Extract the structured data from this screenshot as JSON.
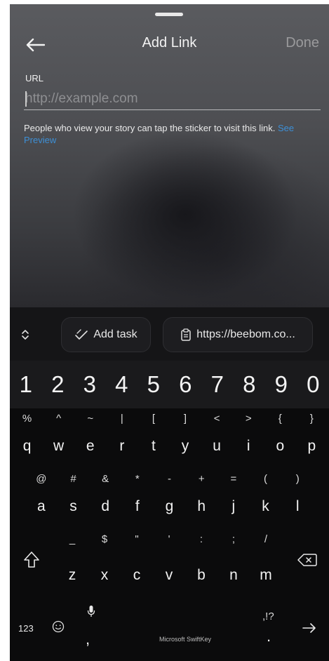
{
  "header": {
    "title": "Add Link",
    "done_label": "Done"
  },
  "url_field": {
    "label": "URL",
    "placeholder": "http://example.com",
    "value": ""
  },
  "help": {
    "text": "People who view your story can tap the sticker to visit this link. ",
    "link_text": "See Preview"
  },
  "keyboard": {
    "suggestions": {
      "add_task": "Add task",
      "clipboard": "https://beebom.co..."
    },
    "number_row": [
      "1",
      "2",
      "3",
      "4",
      "5",
      "6",
      "7",
      "8",
      "9",
      "0"
    ],
    "row1": [
      {
        "sym": "%",
        "main": "q"
      },
      {
        "sym": "^",
        "main": "w"
      },
      {
        "sym": "~",
        "main": "e"
      },
      {
        "sym": "|",
        "main": "r"
      },
      {
        "sym": "[",
        "main": "t"
      },
      {
        "sym": "]",
        "main": "y"
      },
      {
        "sym": "<",
        "main": "u"
      },
      {
        "sym": ">",
        "main": "i"
      },
      {
        "sym": "{",
        "main": "o"
      },
      {
        "sym": "}",
        "main": "p"
      }
    ],
    "row2": [
      {
        "sym": "@",
        "main": "a"
      },
      {
        "sym": "#",
        "main": "s"
      },
      {
        "sym": "&",
        "main": "d"
      },
      {
        "sym": "*",
        "main": "f"
      },
      {
        "sym": "-",
        "main": "g"
      },
      {
        "sym": "+",
        "main": "h"
      },
      {
        "sym": "=",
        "main": "j"
      },
      {
        "sym": "(",
        "main": "k"
      },
      {
        "sym": ")",
        "main": "l"
      }
    ],
    "row3": [
      {
        "sym": "_",
        "main": "z"
      },
      {
        "sym": "$",
        "main": "x"
      },
      {
        "sym": "\"",
        "main": "c"
      },
      {
        "sym": "'",
        "main": "v"
      },
      {
        "sym": ":",
        "main": "b"
      },
      {
        "sym": ";",
        "main": "n"
      },
      {
        "sym": "/",
        "main": "m"
      }
    ],
    "bottom": {
      "numbers_label": "123",
      "comma": ",",
      "space_brand": "Microsoft SwiftKey",
      "punct_label": ",!?",
      "period": "."
    }
  }
}
